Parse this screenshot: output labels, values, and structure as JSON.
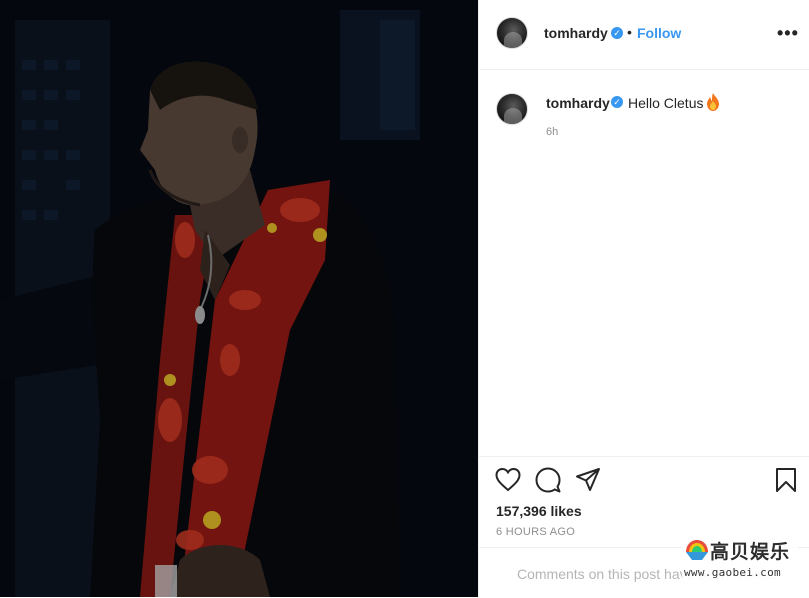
{
  "post": {
    "photo": {
      "description_icon": "photo"
    },
    "header": {
      "username": "tomhardy",
      "verified_icon": "verified-badge-icon",
      "separator": "•",
      "follow_label": "Follow",
      "more_icon": "more-options-icon",
      "more_glyph": "•••"
    },
    "caption": {
      "username": "tomhardy",
      "text": "Hello Cletus",
      "emoji_icon": "fire-emoji-icon",
      "time": "6h"
    },
    "actions": {
      "like_icon": "heart-icon",
      "comment_icon": "comment-icon",
      "share_icon": "share-icon",
      "save_icon": "bookmark-icon"
    },
    "likes": "157,396 likes",
    "posted_time": "6 HOURS AGO",
    "comment_input": {
      "text": "Comments on this post have been limited."
    },
    "watermark": {
      "name": "高贝娱乐",
      "url": "www.gaobei.com"
    }
  },
  "colors": {
    "link_blue": "#3897f0",
    "text": "#262626",
    "muted": "#8e8e8e",
    "border": "#efefef"
  }
}
